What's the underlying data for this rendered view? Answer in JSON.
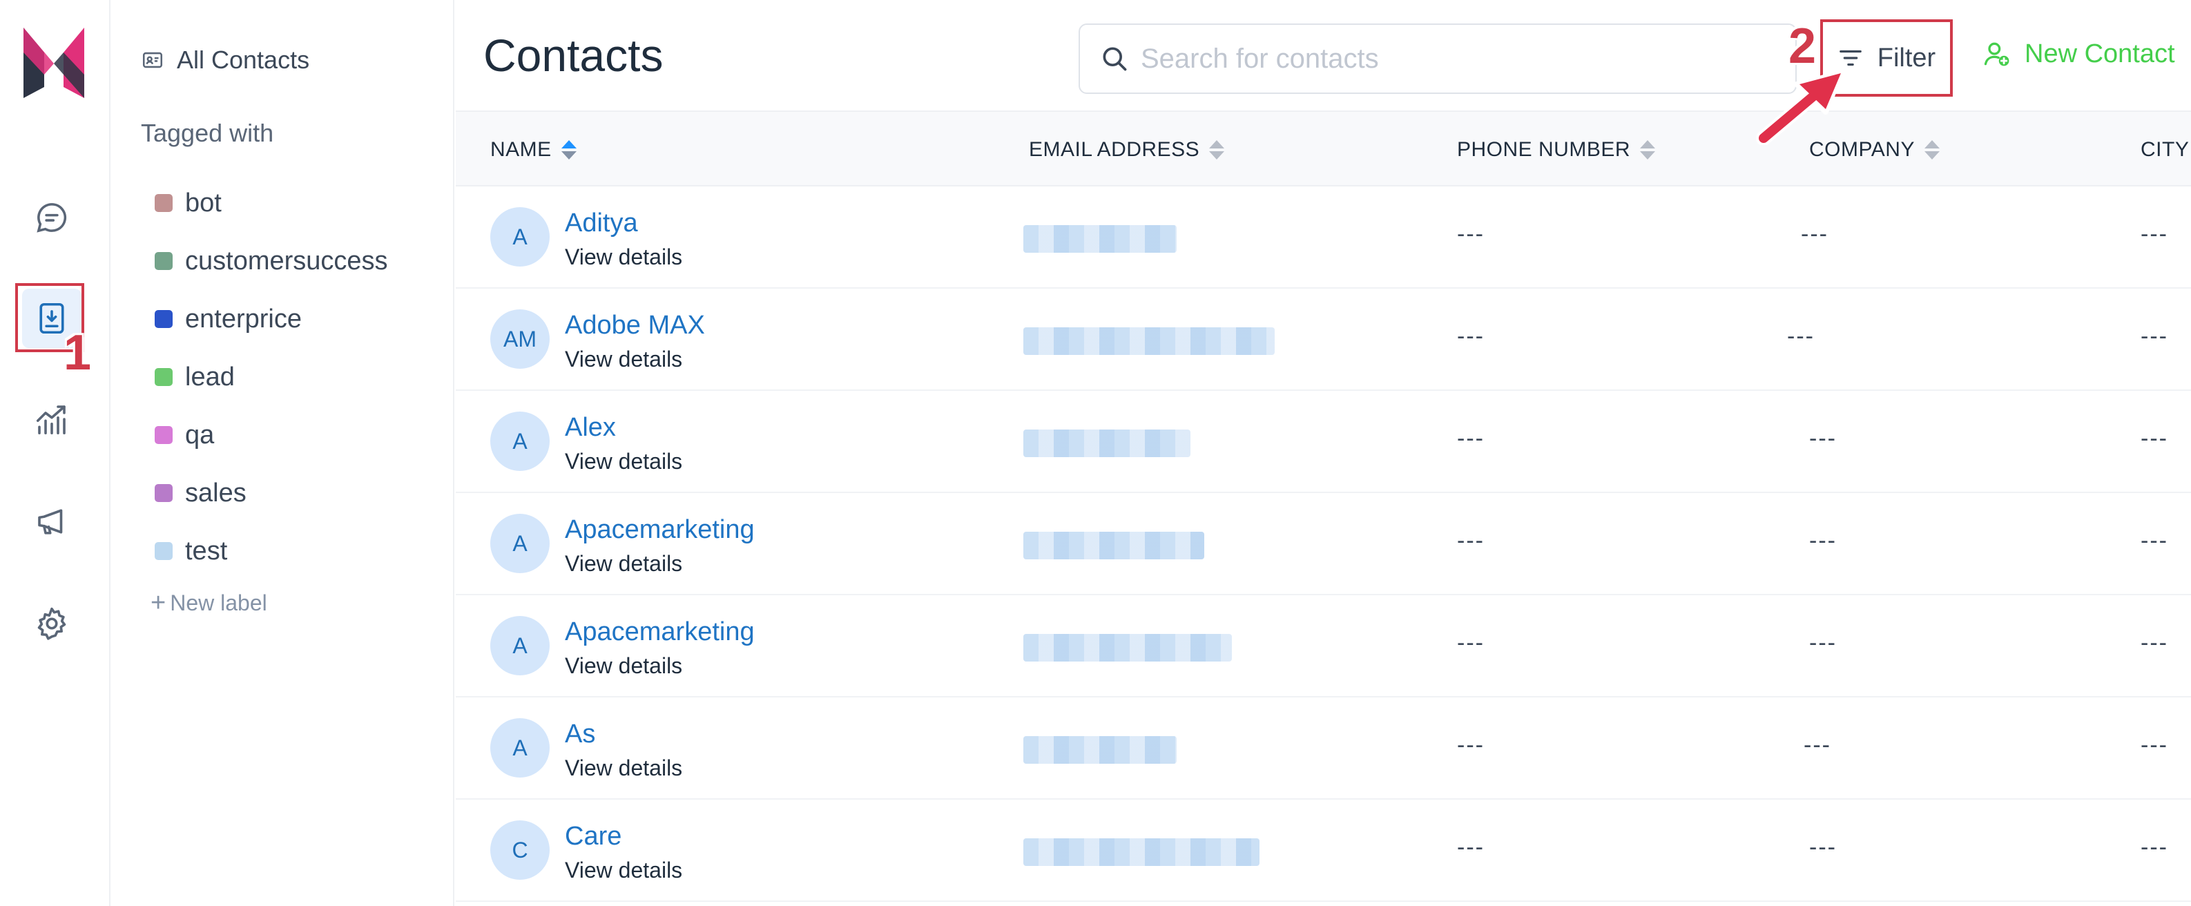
{
  "nav": {
    "items": [
      {
        "id": "conversations",
        "icon": "chat-bubble-icon"
      },
      {
        "id": "contacts",
        "icon": "contacts-book-icon",
        "active": true
      },
      {
        "id": "reports",
        "icon": "chart-line-icon"
      },
      {
        "id": "campaigns",
        "icon": "megaphone-icon"
      },
      {
        "id": "settings",
        "icon": "gear-icon"
      }
    ]
  },
  "sidebar": {
    "all_contacts": "All Contacts",
    "tagged_heading": "Tagged with",
    "tags": [
      {
        "label": "bot",
        "color": "#c19191"
      },
      {
        "label": "customersuccess",
        "color": "#74a38a"
      },
      {
        "label": "enterprice",
        "color": "#2a53c9"
      },
      {
        "label": "lead",
        "color": "#6cc96f"
      },
      {
        "label": "qa",
        "color": "#d77bd7"
      },
      {
        "label": "sales",
        "color": "#b77bc9"
      },
      {
        "label": "test",
        "color": "#bcd8f0"
      }
    ],
    "new_label": "New label"
  },
  "header": {
    "title": "Contacts",
    "search_placeholder": "Search for contacts",
    "filter_label": "Filter",
    "new_contact_label": "New Contact"
  },
  "table": {
    "columns": [
      "NAME",
      "EMAIL ADDRESS",
      "PHONE NUMBER",
      "COMPANY",
      "CITY"
    ],
    "view_details": "View details",
    "placeholder_value": "---",
    "rows": [
      {
        "initials": "A",
        "name": "Aditya"
      },
      {
        "initials": "AM",
        "name": "Adobe MAX"
      },
      {
        "initials": "A",
        "name": "Alex"
      },
      {
        "initials": "A",
        "name": "Apacemarketing"
      },
      {
        "initials": "A",
        "name": "Apacemarketing"
      },
      {
        "initials": "A",
        "name": "As"
      },
      {
        "initials": "C",
        "name": "Care"
      }
    ]
  },
  "annotations": {
    "step1": "1",
    "step2": "2",
    "color": "#d03a4a"
  },
  "colors": {
    "accent": "#1f93ff",
    "link": "#1f74c4",
    "success": "#44ce4b"
  }
}
